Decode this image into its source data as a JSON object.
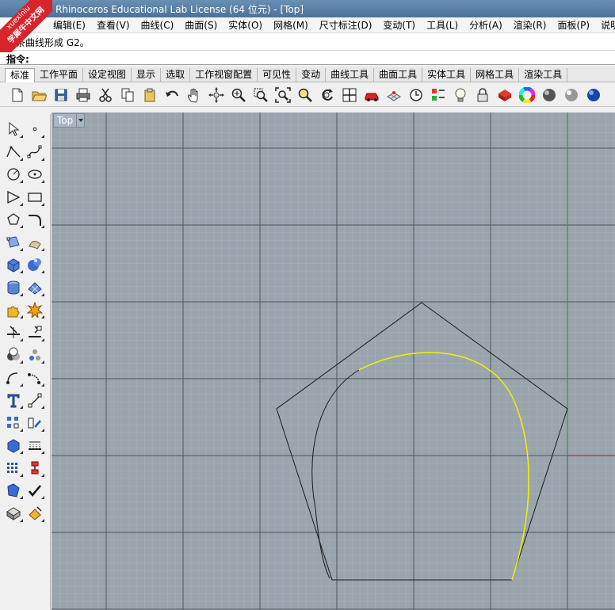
{
  "watermark": {
    "site": "xuexiniu",
    "name": "学犀牛中文网"
  },
  "window": {
    "title": "Rhinoceros Educational Lab License (64 位元) - [Top]"
  },
  "menu": [
    "编辑(E)",
    "查看(V)",
    "曲线(C)",
    "曲面(S)",
    "实体(O)",
    "网格(M)",
    "尺寸标注(D)",
    "变动(T)",
    "工具(L)",
    "分析(A)",
    "渲染(R)",
    "面板(P)",
    "说明(H)"
  ],
  "command": {
    "history": "调条曲线形成 G2。",
    "prompt": "指令:",
    "input_value": ""
  },
  "tabs": [
    {
      "label": "标准",
      "active": true
    },
    {
      "label": "工作平面",
      "active": false
    },
    {
      "label": "设定视图",
      "active": false
    },
    {
      "label": "显示",
      "active": false
    },
    {
      "label": "选取",
      "active": false
    },
    {
      "label": "工作视窗配置",
      "active": false
    },
    {
      "label": "可见性",
      "active": false
    },
    {
      "label": "变动",
      "active": false
    },
    {
      "label": "曲线工具",
      "active": false
    },
    {
      "label": "曲面工具",
      "active": false
    },
    {
      "label": "实体工具",
      "active": false
    },
    {
      "label": "网格工具",
      "active": false
    },
    {
      "label": "渲染工具",
      "active": false
    }
  ],
  "toolbar_icons": [
    "new-file-icon",
    "open-folder-icon",
    "save-icon",
    "print-icon",
    "cut-icon",
    "copy-icon",
    "paste-icon",
    "undo-icon",
    "pan-hand-icon",
    "rotate-view-icon",
    "zoom-icon",
    "zoom-window-icon",
    "zoom-extents-icon",
    "zoom-selected-icon",
    "rotate-icon",
    "four-viewports-icon",
    "car-icon",
    "grid-snap-icon",
    "clock-icon",
    "properties-icon",
    "light-bulb-icon",
    "lock-icon",
    "render-icon",
    "color-wheel-icon",
    "sphere-shaded-icon",
    "sphere-rendered-icon",
    "sphere-blue-icon"
  ],
  "left_tool_icons": [
    [
      "select-arrow-icon",
      "point-icon"
    ],
    [
      "polyline-icon",
      "control-point-curve-icon"
    ],
    [
      "circle-icon",
      "ellipse-icon"
    ],
    [
      "arc-icon",
      "rectangle-icon"
    ],
    [
      "polygon-icon",
      "fillet-curve-icon"
    ],
    [
      "surface-corner-icon",
      "surface-extrude-icon"
    ],
    [
      "box-icon",
      "sphere-icon"
    ],
    [
      "cylinder-icon",
      "mesh-plane-icon"
    ],
    [
      "puzzle-icon",
      "explode-icon"
    ],
    [
      "trim-icon",
      "split-icon"
    ],
    [
      "boolean-icon",
      "group-icon"
    ],
    [
      "offset-curve-icon",
      "curve-tools-icon"
    ],
    [
      "text-icon",
      "dimension-icon"
    ],
    [
      "block-icon",
      "transform-icon"
    ],
    [
      "solid-box-icon",
      "grid-array-icon"
    ],
    [
      "array-icon",
      "history-icon"
    ],
    [
      "analyze-icon",
      "check-icon"
    ],
    [
      "shade-icon",
      "paint-icon"
    ]
  ],
  "viewport": {
    "name": "Top",
    "colors": {
      "background": "#9aa4ad",
      "minor_grid": "#a3acb4",
      "major_grid": "#4e565d",
      "x_axis": "#c82828",
      "y_axis": "#2ea02e",
      "curve": "#1a1a1a",
      "selected_curve": "#f2f000"
    }
  }
}
